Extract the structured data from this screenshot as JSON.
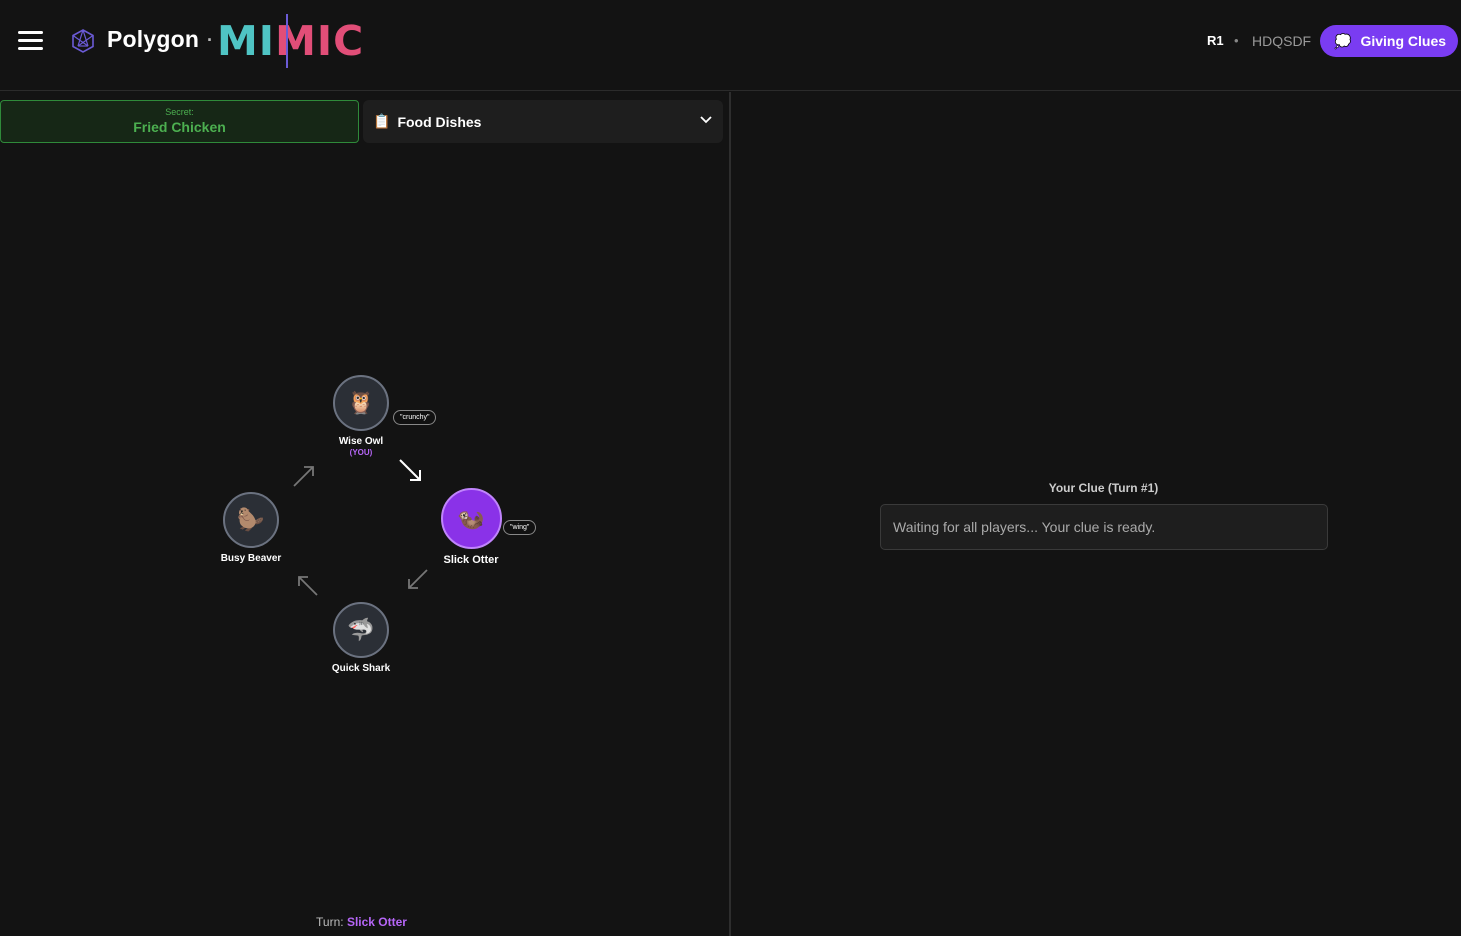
{
  "header": {
    "brand": "Polygon",
    "dot": "·",
    "mimic_part1": "MI",
    "mimic_part2": "MIC",
    "round": "R1",
    "separator": "•",
    "room_code": "HDQSDF",
    "phase_label": "Giving Clues",
    "phase_icon": "💭"
  },
  "secret": {
    "label": "Secret:",
    "value": "Fried Chicken"
  },
  "category": {
    "icon": "📋",
    "label": "Food Dishes"
  },
  "players": [
    {
      "name": "Wise Owl",
      "emoji": "🦉",
      "you_label": "(YOU)",
      "clue": "\"crunchy\""
    },
    {
      "name": "Slick Otter",
      "emoji": "🦦",
      "clue": "\"wing\""
    },
    {
      "name": "Quick Shark",
      "emoji": "🦈"
    },
    {
      "name": "Busy Beaver",
      "emoji": "🦫"
    }
  ],
  "turn": {
    "label": "Turn:",
    "player": "Slick Otter"
  },
  "clue_panel": {
    "title": "Your Clue (Turn #1)",
    "status": "Waiting for all players... Your clue is ready."
  },
  "colors": {
    "accent_purple": "#7a3cf2",
    "secret_green": "#4caf50",
    "mimic_teal": "#4fc4c4",
    "mimic_pink": "#e14e78"
  }
}
